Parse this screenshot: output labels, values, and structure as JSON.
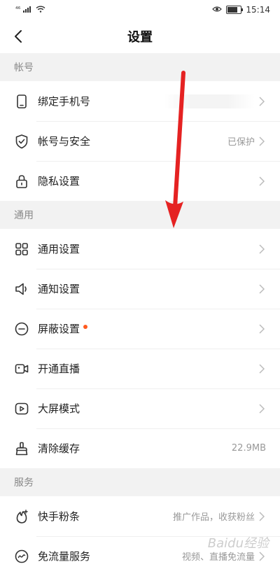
{
  "status_bar": {
    "network": "⁴⁶",
    "time": "15:14"
  },
  "header": {
    "title": "设置"
  },
  "sections": [
    {
      "title": "帐号",
      "items": [
        {
          "label": "绑定手机号",
          "value": ""
        },
        {
          "label": "帐号与安全",
          "value": "已保护"
        },
        {
          "label": "隐私设置",
          "value": ""
        }
      ]
    },
    {
      "title": "通用",
      "items": [
        {
          "label": "通用设置",
          "value": ""
        },
        {
          "label": "通知设置",
          "value": ""
        },
        {
          "label": "屏蔽设置",
          "value": ""
        },
        {
          "label": "开通直播",
          "value": ""
        },
        {
          "label": "大屏模式",
          "value": ""
        },
        {
          "label": "清除缓存",
          "value": "22.9MB"
        }
      ]
    },
    {
      "title": "服务",
      "items": [
        {
          "label": "快手粉条",
          "value": "推广作品，收获粉丝"
        },
        {
          "label": "免流量服务",
          "value": "视频、直播免流量"
        }
      ]
    }
  ],
  "colors": {
    "arrow": "#e52222",
    "badge_dot": "#ff5a1f"
  },
  "watermark": "Baidu经验"
}
